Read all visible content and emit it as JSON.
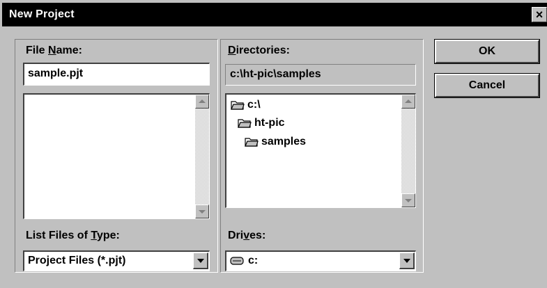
{
  "window": {
    "title": "New Project",
    "close_glyph": "×"
  },
  "file_name": {
    "label_pre": "File ",
    "label_key": "N",
    "label_post": "ame:",
    "value": "sample.pjt",
    "files": []
  },
  "directories": {
    "label_key": "D",
    "label_post": "irectories:",
    "current_path": "c:\\ht-pic\\samples",
    "tree": [
      {
        "label": "c:\\",
        "icon": "open-folder-icon"
      },
      {
        "label": "ht-pic",
        "icon": "open-folder-icon"
      },
      {
        "label": "samples",
        "icon": "open-folder-icon"
      }
    ]
  },
  "file_type": {
    "label_pre": "List Files of ",
    "label_key": "T",
    "label_post": "ype:",
    "selected": "Project Files (*.pjt)"
  },
  "drives": {
    "label_pre": "Dri",
    "label_key": "v",
    "label_post": "es:",
    "selected": "c:",
    "icon": "hard-drive-icon"
  },
  "buttons": {
    "ok": "OK",
    "cancel": "Cancel"
  },
  "colors": {
    "face": "#c0c0c0",
    "titlebar": "#000000",
    "field": "#ffffff"
  }
}
